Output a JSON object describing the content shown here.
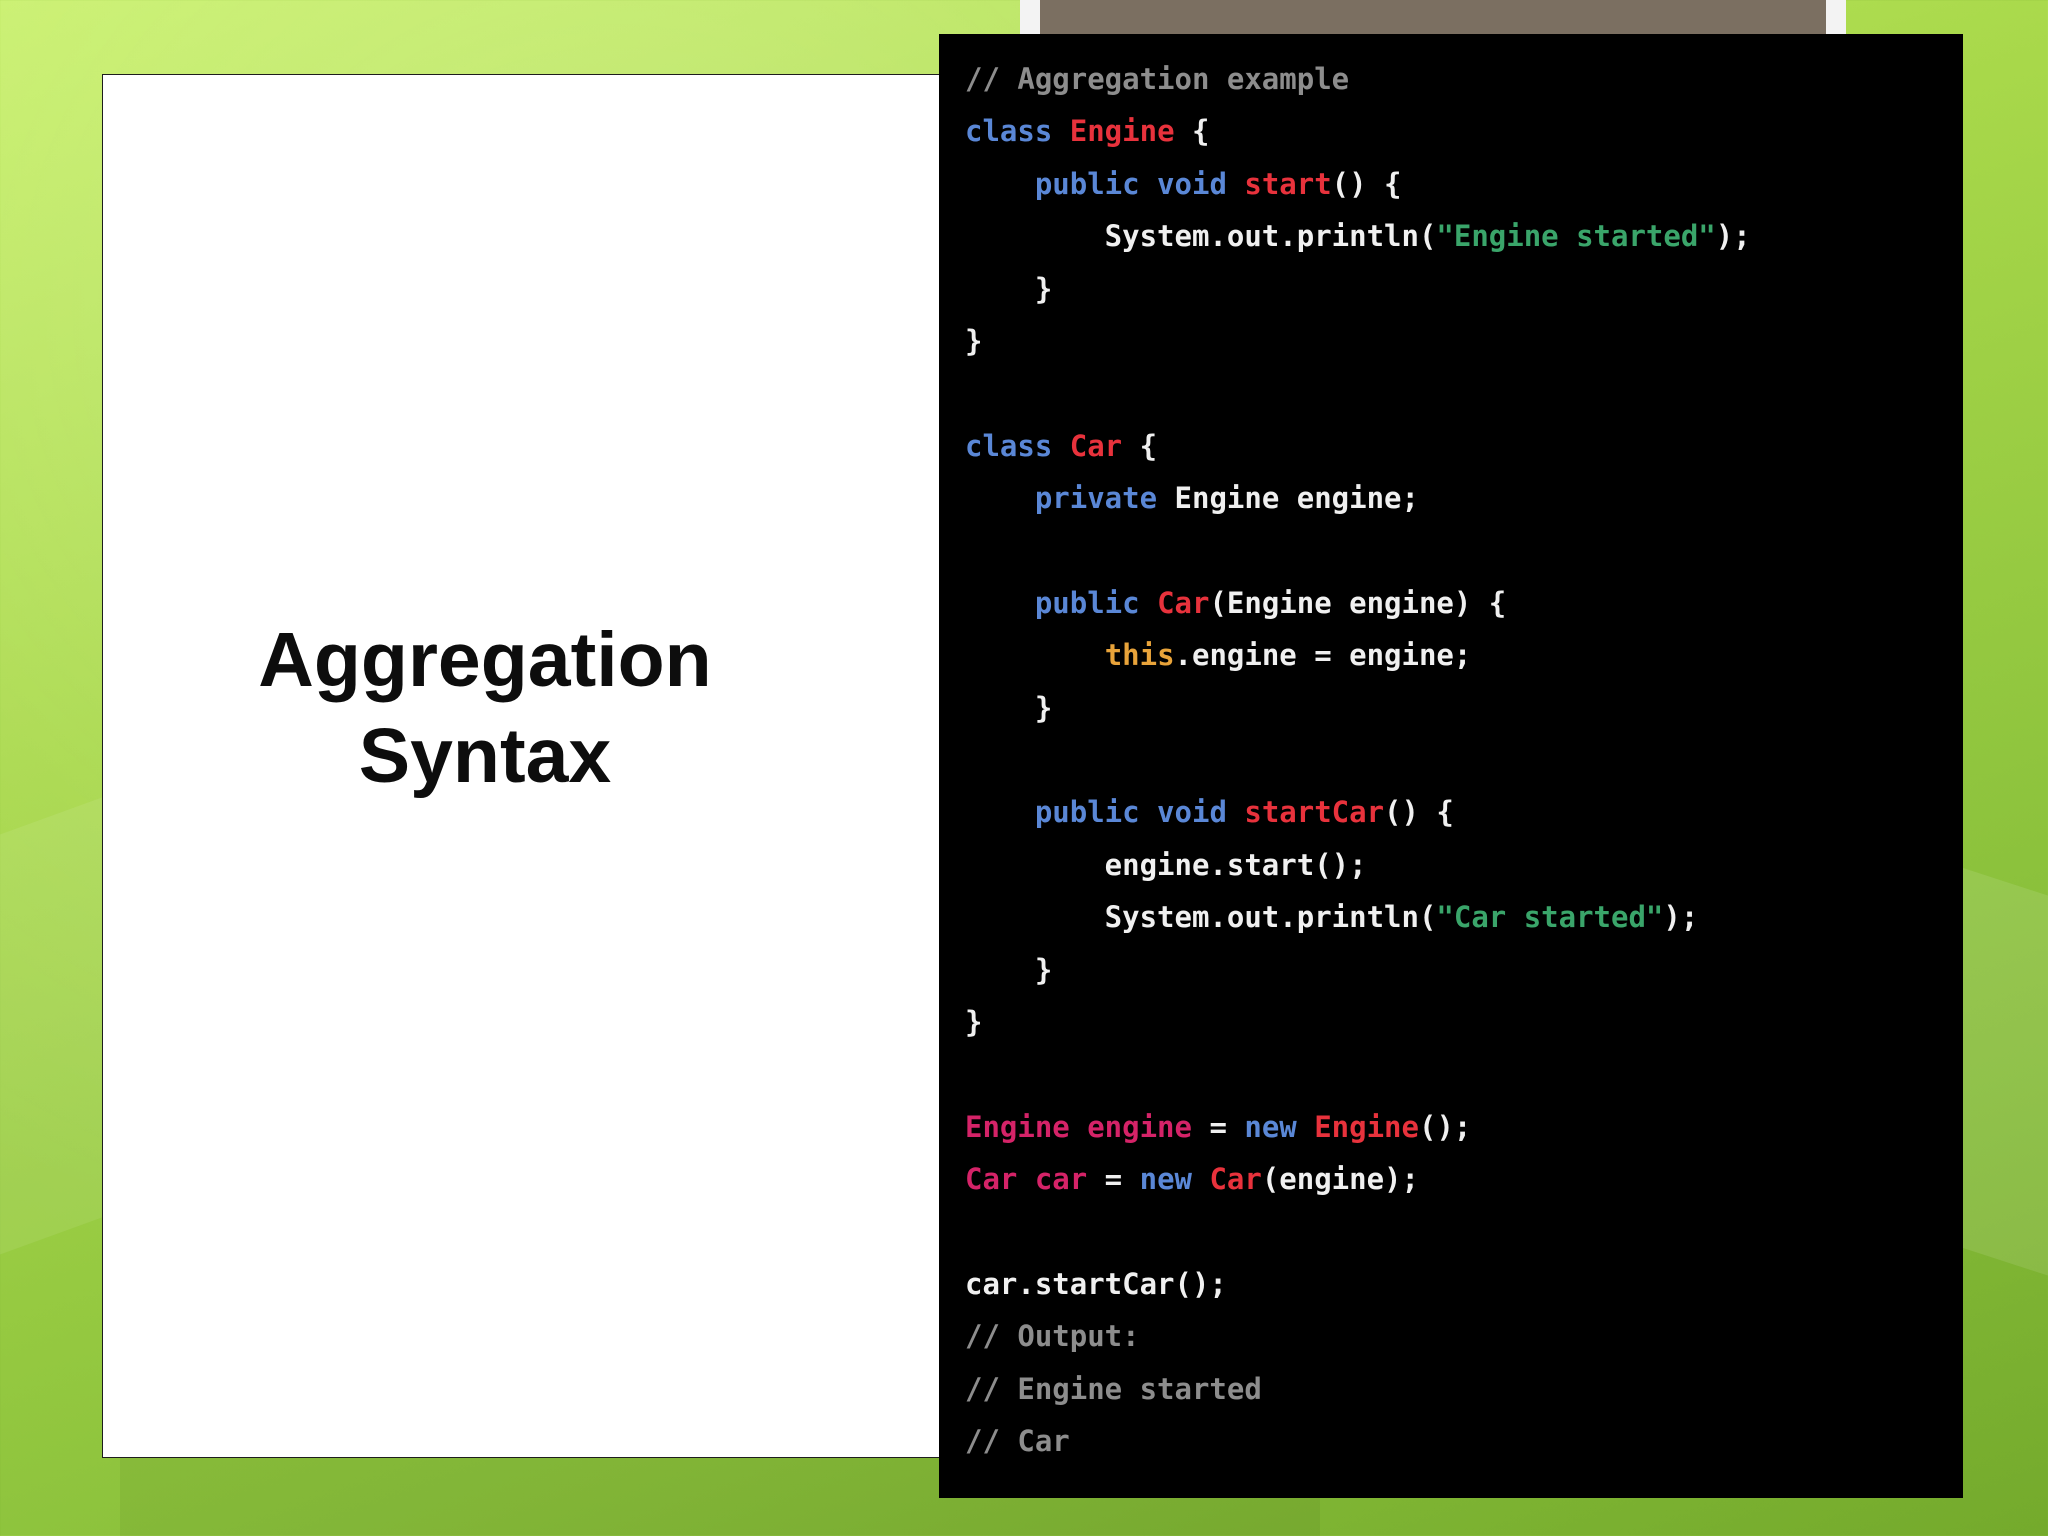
{
  "slide": {
    "title_line1": "Aggregation",
    "title_line2": "Syntax"
  },
  "code": {
    "lines": [
      [
        {
          "t": "// Aggregation example",
          "c": "c"
        }
      ],
      [
        {
          "t": "class ",
          "c": "k"
        },
        {
          "t": "Engine",
          "c": "n"
        },
        {
          "t": " {",
          "c": "p"
        }
      ],
      [
        {
          "t": "    ",
          "c": "p"
        },
        {
          "t": "public void ",
          "c": "k"
        },
        {
          "t": "start",
          "c": "n"
        },
        {
          "t": "() {",
          "c": "p"
        }
      ],
      [
        {
          "t": "        System.out.println(",
          "c": "p"
        },
        {
          "t": "\"Engine started\"",
          "c": "s"
        },
        {
          "t": ");",
          "c": "p"
        }
      ],
      [
        {
          "t": "    }",
          "c": "p"
        }
      ],
      [
        {
          "t": "}",
          "c": "p"
        }
      ],
      [],
      [
        {
          "t": "class ",
          "c": "k"
        },
        {
          "t": "Car",
          "c": "n"
        },
        {
          "t": " {",
          "c": "p"
        }
      ],
      [
        {
          "t": "    ",
          "c": "p"
        },
        {
          "t": "private ",
          "c": "k"
        },
        {
          "t": "Engine engine;",
          "c": "p"
        }
      ],
      [],
      [
        {
          "t": "    ",
          "c": "p"
        },
        {
          "t": "public ",
          "c": "k"
        },
        {
          "t": "Car",
          "c": "n"
        },
        {
          "t": "(Engine engine) {",
          "c": "p"
        }
      ],
      [
        {
          "t": "        ",
          "c": "p"
        },
        {
          "t": "this",
          "c": "t"
        },
        {
          "t": ".engine = engine;",
          "c": "p"
        }
      ],
      [
        {
          "t": "    }",
          "c": "p"
        }
      ],
      [],
      [
        {
          "t": "    ",
          "c": "p"
        },
        {
          "t": "public void ",
          "c": "k"
        },
        {
          "t": "startCar",
          "c": "n"
        },
        {
          "t": "() {",
          "c": "p"
        }
      ],
      [
        {
          "t": "        engine.start();",
          "c": "p"
        }
      ],
      [
        {
          "t": "        System.out.println(",
          "c": "p"
        },
        {
          "t": "\"Car started\"",
          "c": "s"
        },
        {
          "t": ");",
          "c": "p"
        }
      ],
      [
        {
          "t": "    }",
          "c": "p"
        }
      ],
      [
        {
          "t": "}",
          "c": "p"
        }
      ],
      [],
      [
        {
          "t": "Engine engine",
          "c": "v"
        },
        {
          "t": " = ",
          "c": "p"
        },
        {
          "t": "new ",
          "c": "k"
        },
        {
          "t": "Engine",
          "c": "n"
        },
        {
          "t": "();",
          "c": "p"
        }
      ],
      [
        {
          "t": "Car car",
          "c": "v"
        },
        {
          "t": " = ",
          "c": "p"
        },
        {
          "t": "new ",
          "c": "k"
        },
        {
          "t": "Car",
          "c": "n"
        },
        {
          "t": "(engine);",
          "c": "p"
        }
      ],
      [],
      [
        {
          "t": "car.startCar();",
          "c": "p"
        }
      ],
      [
        {
          "t": "// Output:",
          "c": "c"
        }
      ],
      [
        {
          "t": "// Engine started",
          "c": "c"
        }
      ],
      [
        {
          "t": "// Car",
          "c": "c"
        }
      ]
    ]
  },
  "colors": {
    "background_green": "#a8d84a",
    "code_background": "#000000",
    "keyword": "#5a87d6",
    "identifier_red": "#e8323c",
    "string": "#3aa56a",
    "this_keyword": "#e8a33a",
    "comment": "#8d8d8d",
    "variable_pink": "#d52368"
  }
}
